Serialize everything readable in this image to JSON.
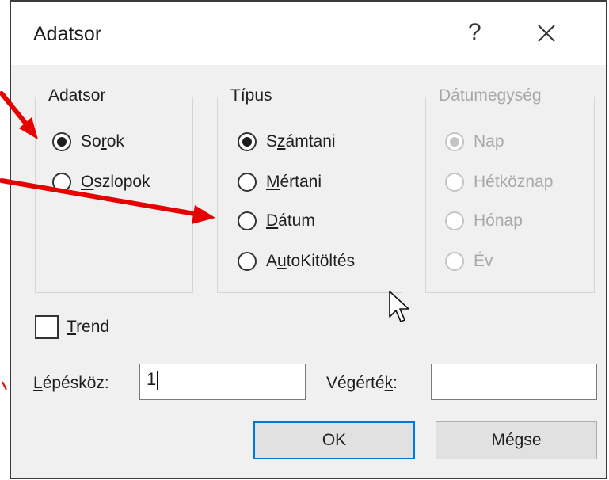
{
  "dialog": {
    "title": "Adatsor",
    "help_label": "?"
  },
  "group_series": {
    "legend": "Adatsor",
    "options": [
      {
        "pre": "So",
        "u": "r",
        "post": "ok",
        "checked": true
      },
      {
        "pre": "",
        "u": "O",
        "post": "szlopok",
        "checked": false
      }
    ]
  },
  "group_type": {
    "legend": "Típus",
    "options": [
      {
        "pre": "S",
        "u": "z",
        "post": "ámtani",
        "checked": true
      },
      {
        "pre": "",
        "u": "M",
        "post": "értani",
        "checked": false
      },
      {
        "pre": "",
        "u": "D",
        "post": "átum",
        "checked": false
      },
      {
        "pre": "A",
        "u": "u",
        "post": "toKitöltés",
        "checked": false
      }
    ]
  },
  "group_date": {
    "legend": "Dátumegység",
    "options": [
      {
        "label": "Nap",
        "checked": true
      },
      {
        "label": "Hétköznap",
        "checked": false
      },
      {
        "label": "Hónap",
        "checked": false
      },
      {
        "label": "Év",
        "checked": false
      }
    ]
  },
  "trend": {
    "u": "T",
    "post": "rend",
    "checked": false
  },
  "step": {
    "pre": "",
    "u": "L",
    "post": "épésköz:",
    "value": "1"
  },
  "stop": {
    "pre": "Végérté",
    "u": "k",
    "post": ":",
    "value": ""
  },
  "buttons": {
    "ok": "OK",
    "cancel": "Mégse"
  },
  "annotation_color": "#e60000"
}
